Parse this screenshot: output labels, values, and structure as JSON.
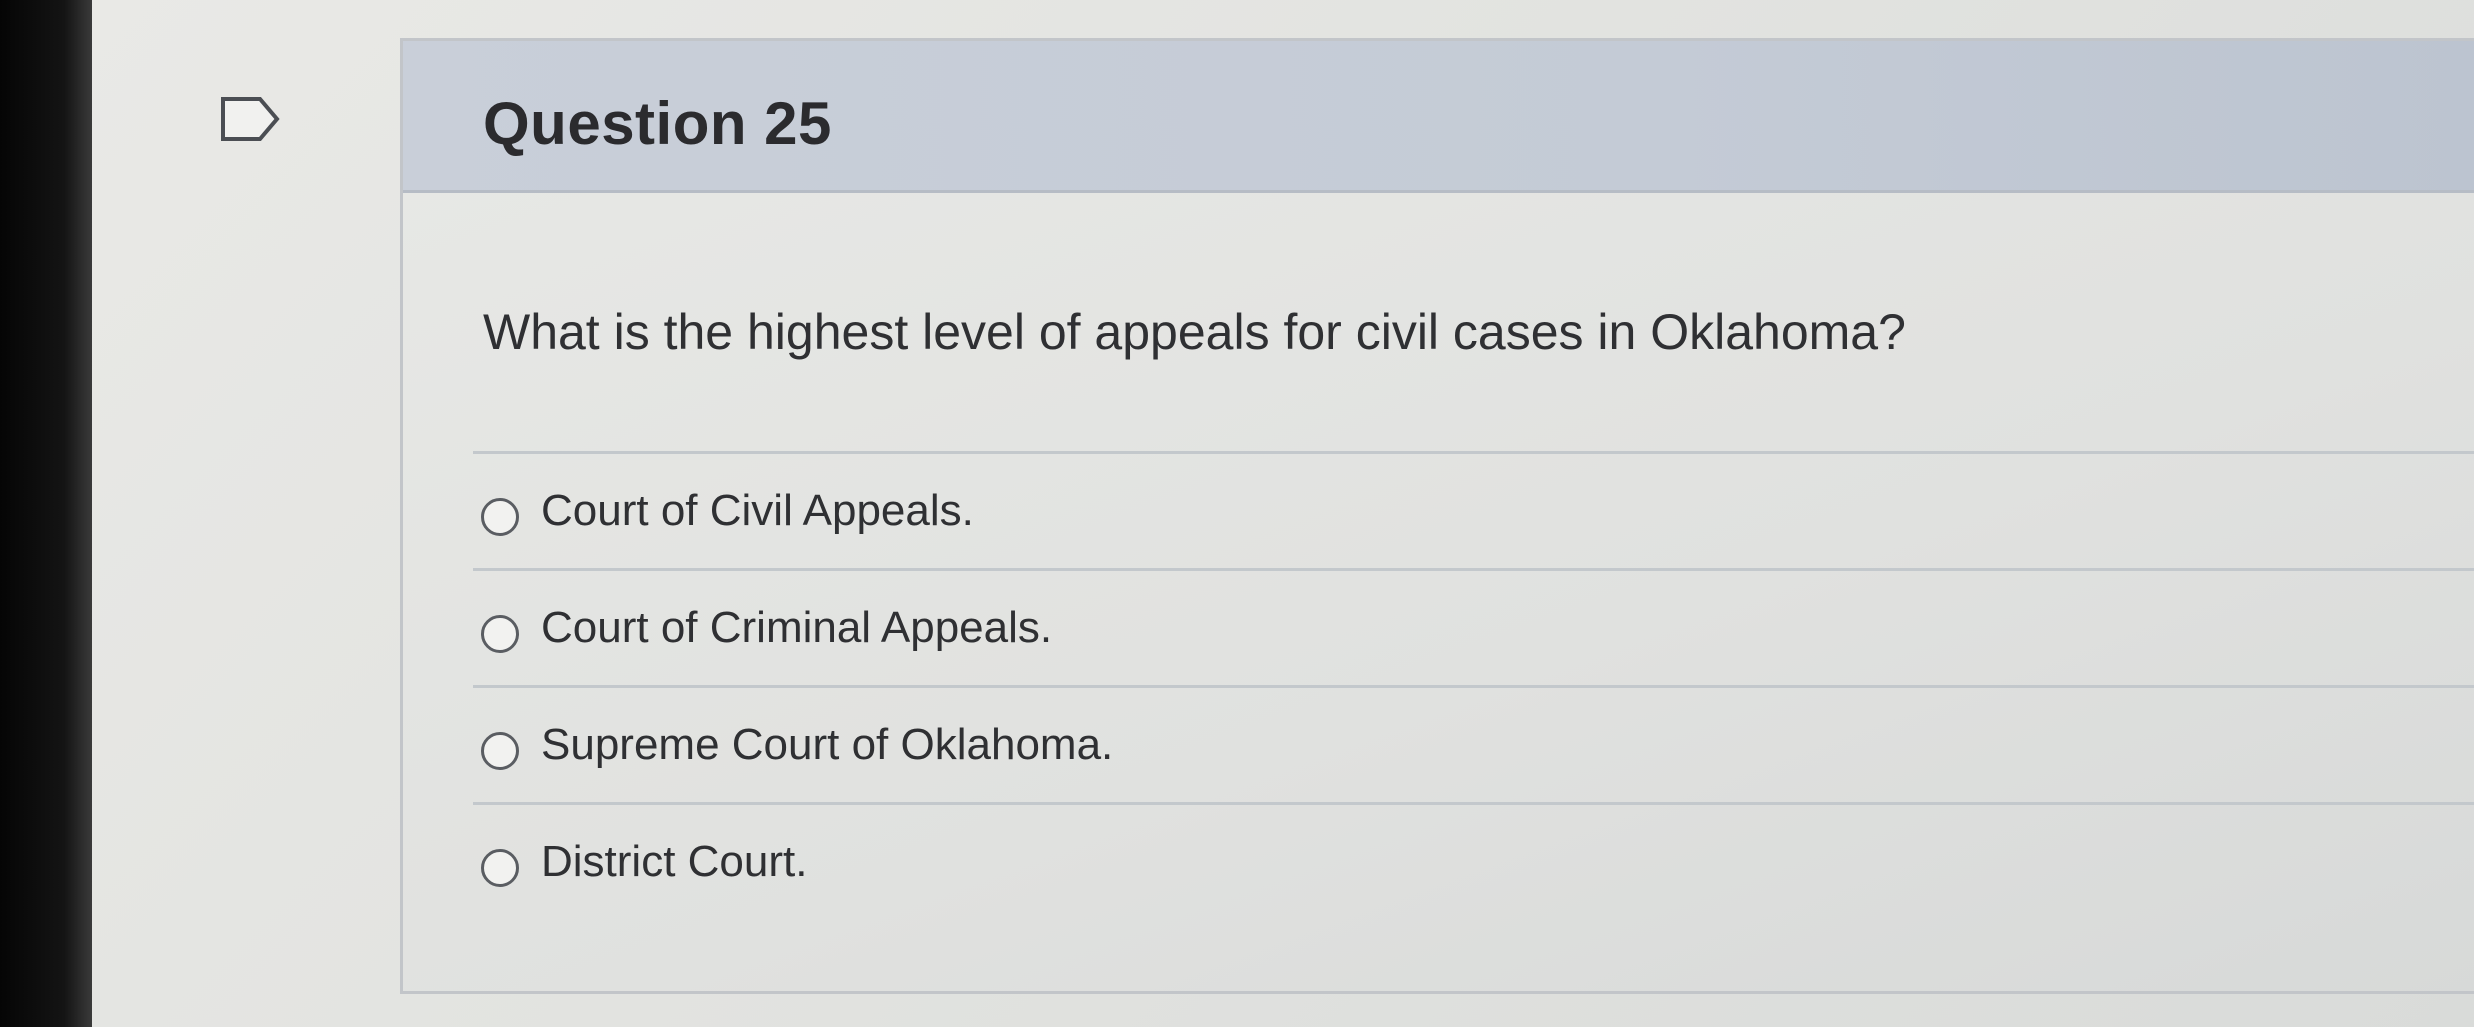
{
  "question": {
    "title": "Question 25",
    "text": "What is the highest level of appeals for civil cases in Oklahoma?",
    "options": [
      {
        "label": "Court of Civil Appeals."
      },
      {
        "label": "Court of Criminal Appeals."
      },
      {
        "label": "Supreme Court of Oklahoma."
      },
      {
        "label": "District Court."
      }
    ]
  },
  "icons": {
    "flag": "flag-question-icon",
    "radio": "radio-button"
  },
  "colors": {
    "header_background": "#c9cfd9",
    "card_border": "#c2c5c9",
    "text": "#2f3033"
  }
}
